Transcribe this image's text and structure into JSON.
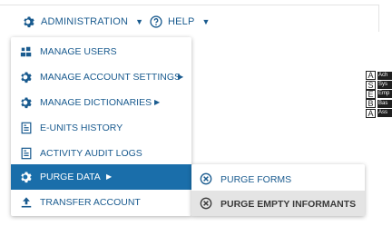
{
  "nav": {
    "administration": {
      "label": "ADMINISTRATION",
      "icon": "gear-icon"
    },
    "help": {
      "label": "HELP",
      "icon": "help-circle-icon"
    }
  },
  "menu": {
    "items": [
      {
        "label": "MANAGE USERS",
        "icon": "users-icon"
      },
      {
        "label": "MANAGE ACCOUNT SETTINGS",
        "icon": "gear-icon"
      },
      {
        "label": "MANAGE DICTIONARIES",
        "icon": "gear-icon"
      },
      {
        "label": "E-UNITS HISTORY",
        "icon": "document-icon"
      },
      {
        "label": "ACTIVITY AUDIT LOGS",
        "icon": "document-icon"
      },
      {
        "label": "PURGE DATA",
        "icon": "gear-icon"
      },
      {
        "label": "TRANSFER ACCOUNT",
        "icon": "upload-icon"
      }
    ]
  },
  "submenu": {
    "items": [
      {
        "label": "PURGE FORMS",
        "icon": "circle-x-icon"
      },
      {
        "label": "PURGE EMPTY INFORMANTS",
        "icon": "circle-x-icon"
      }
    ]
  },
  "legend": {
    "rows": [
      {
        "key": "A",
        "value": "Ach"
      },
      {
        "key": "S",
        "value": "Sys"
      },
      {
        "key": "E",
        "value": "Emp"
      },
      {
        "key": "B",
        "value": "Bas"
      },
      {
        "key": "A",
        "value": "Ass"
      }
    ]
  },
  "colors": {
    "accent": "#1a6eaa",
    "link": "#1a5b8f",
    "hover_bg": "#e4e4e4"
  }
}
